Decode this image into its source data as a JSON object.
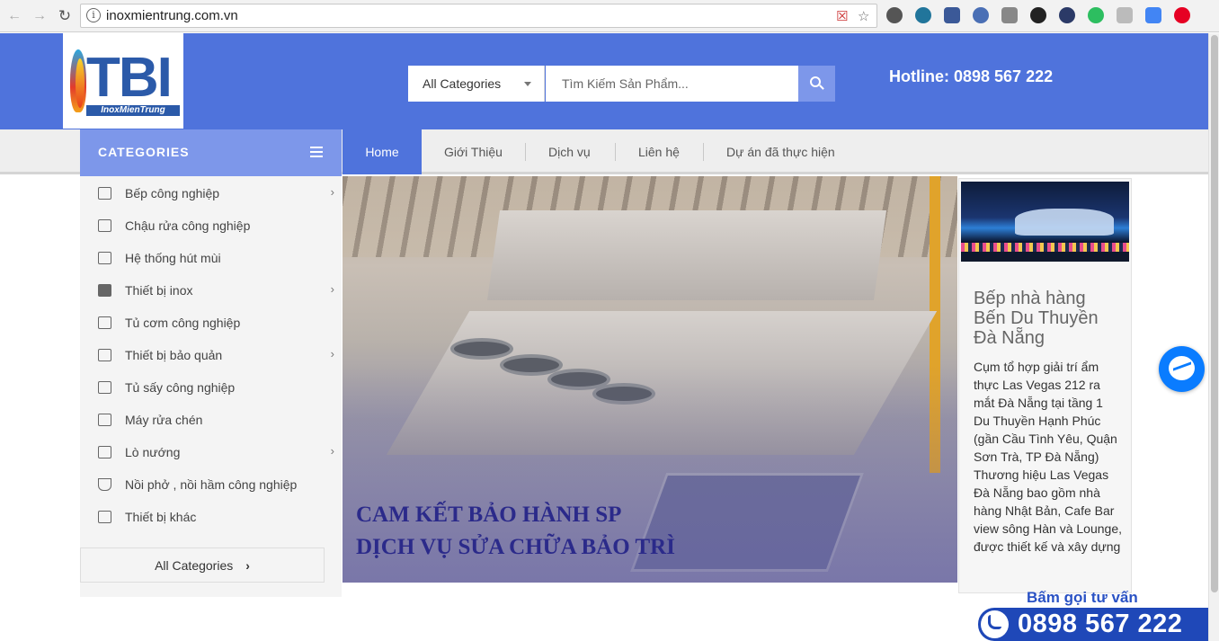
{
  "browser": {
    "url": "inoxmientrung.com.vn"
  },
  "header": {
    "logo_text": "TBI",
    "logo_sub": "InoxMienTrung",
    "search_category": "All Categories",
    "search_placeholder": "Tìm Kiếm Sản Phẩm...",
    "hotline": "Hotline: 0898 567 222"
  },
  "nav": {
    "categories_label": "CATEGORIES",
    "items": [
      {
        "label": "Home"
      },
      {
        "label": "Giới Thiệu"
      },
      {
        "label": "Dịch vụ"
      },
      {
        "label": "Liên hệ"
      },
      {
        "label": "Dự án đã thực hiện"
      }
    ]
  },
  "sidebar": {
    "items": [
      {
        "label": "Bếp công nghiệp"
      },
      {
        "label": "Chậu rửa công nghiệp"
      },
      {
        "label": "Hệ thống hút mùi"
      },
      {
        "label": "Thiết bị inox"
      },
      {
        "label": "Tủ cơm công nghiệp"
      },
      {
        "label": "Thiết bị bảo quản"
      },
      {
        "label": "Tủ sấy công nghiệp"
      },
      {
        "label": "Máy rửa chén"
      },
      {
        "label": "Lò nướng"
      },
      {
        "label": "Nồi phở , nồi hầm công nghiệp"
      },
      {
        "label": "Thiết bị khác"
      }
    ],
    "all_categories": "All Categories"
  },
  "banner": {
    "line1": "CAM KẾT BẢO HÀNH SP",
    "line2": "DỊCH VỤ SỬA CHỮA BẢO TRÌ"
  },
  "post": {
    "title": "Bếp nhà hàng Bến Du Thuyền Đà Nẵng",
    "body": "Cụm tổ hợp giải trí ẩm thực Las Vegas 212  ra mắt Đà Nẵng tại tầng 1 Du Thuyền Hạnh Phúc (gần Cầu Tình Yêu, Quận Sơn Trà, TP Đà Nẵng) Thương hiệu Las Vegas Đà Nẵng bao gồm nhà hàng Nhật Bản, Cafe Bar view sông Hàn và Lounge, được thiết kế và xây dựng"
  },
  "call": {
    "label": "Bấm gọi tư vấn",
    "number": "0898 567 222"
  },
  "colors": {
    "header_blue": "#4f73dc",
    "light_blue": "#7d97ea",
    "call_blue": "#1f48b8"
  }
}
